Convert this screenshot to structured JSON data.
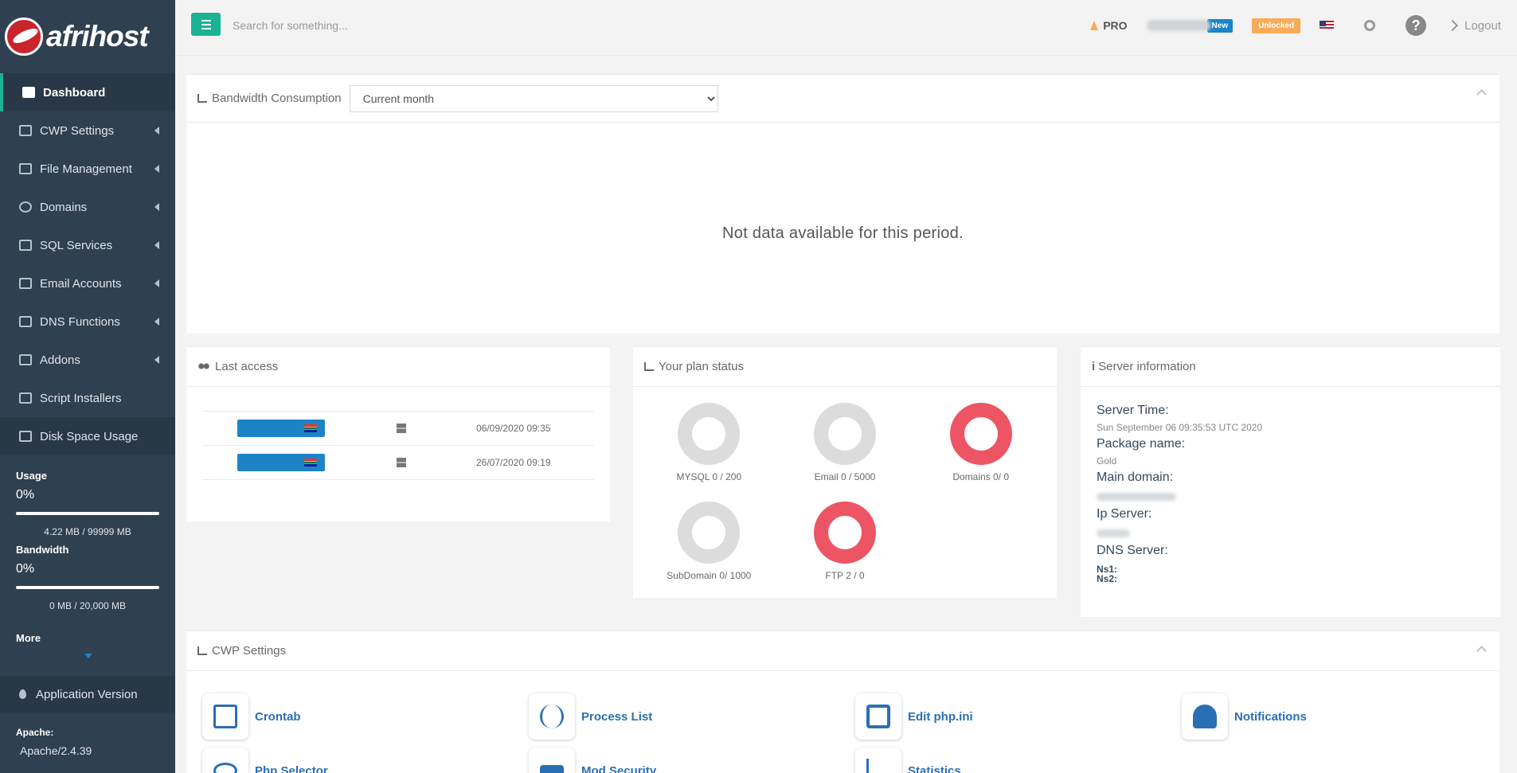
{
  "brand": {
    "name": "afrihost"
  },
  "sidebar": {
    "items": [
      {
        "label": "Dashboard"
      },
      {
        "label": "CWP Settings"
      },
      {
        "label": "File Management"
      },
      {
        "label": "Domains"
      },
      {
        "label": "SQL Services"
      },
      {
        "label": "Email Accounts"
      },
      {
        "label": "DNS Functions"
      },
      {
        "label": "Addons"
      },
      {
        "label": "Script Installers"
      },
      {
        "label": "Disk Space Usage"
      }
    ],
    "usage": {
      "label": "Usage",
      "percent": "0%",
      "amount": "4.22 MB / 99999 MB"
    },
    "bandwidth": {
      "label": "Bandwidth",
      "percent": "0%",
      "amount": "0 MB / 20,000 MB"
    },
    "more_label": "More",
    "app_version_label": "Application Version",
    "apache_label": "Apache:",
    "apache_version": "Apache/2.4.39"
  },
  "topbar": {
    "search_placeholder": "Search for something...",
    "pro_label": "PRO",
    "new_badge": "New",
    "unlocked_badge": "Unlocked",
    "help_glyph": "?",
    "logout_label": "Logout"
  },
  "bandwidth_panel": {
    "title": "Bandwidth Consumption",
    "period_selected": "Current month",
    "empty_message": "Not data available for this period."
  },
  "last_access": {
    "title": "Last access",
    "rows": [
      {
        "date": "06/09/2020 09:35"
      },
      {
        "date": "26/07/2020 09:19"
      }
    ]
  },
  "plan_status": {
    "title": "Your plan status",
    "items": [
      {
        "label": "MYSQL 0 / 200",
        "state": "grey"
      },
      {
        "label": "Email 0 / 5000",
        "state": "grey"
      },
      {
        "label": "Domains 0/ 0",
        "state": "red"
      },
      {
        "label": "SubDomain 0/ 1000",
        "state": "grey"
      },
      {
        "label": "FTP 2 / 0",
        "state": "red"
      }
    ]
  },
  "server_info": {
    "title": "Server information",
    "server_time_label": "Server Time:",
    "server_time": "Sun September 06 09:35:53 UTC 2020",
    "package_label": "Package name:",
    "package": "Gold",
    "main_domain_label": "Main domain:",
    "ip_label": "Ip Server:",
    "dns_label": "DNS Server:",
    "ns1_label": "Ns1:",
    "ns2_label": "Ns2:"
  },
  "cwp_settings": {
    "title": "CWP Settings",
    "tiles": [
      {
        "label": "Crontab",
        "icon": "crontab-icon",
        "color": "#2a6fb5"
      },
      {
        "label": "Process List",
        "icon": "process-list-icon",
        "color": "#2a6fb5"
      },
      {
        "label": "Edit php.ini",
        "icon": "edit-icon",
        "color": "#2a6fb5"
      },
      {
        "label": "Notifications",
        "icon": "bell-icon",
        "color": "#2a6fb5"
      },
      {
        "label": "Php Selector",
        "icon": "php-icon",
        "color": "#2a6fb5"
      },
      {
        "label": "Mod Security",
        "icon": "lock-icon",
        "color": "#2a6fb5"
      },
      {
        "label": "Statistics",
        "icon": "statistics-icon",
        "color": "#2a6fb5"
      }
    ]
  },
  "colors": {
    "accent": "#1ab394",
    "sidebar": "#2f4050",
    "link": "#2a6fb5",
    "danger": "#ed5565",
    "warning": "#f8ac59",
    "info": "#1c84c6"
  }
}
